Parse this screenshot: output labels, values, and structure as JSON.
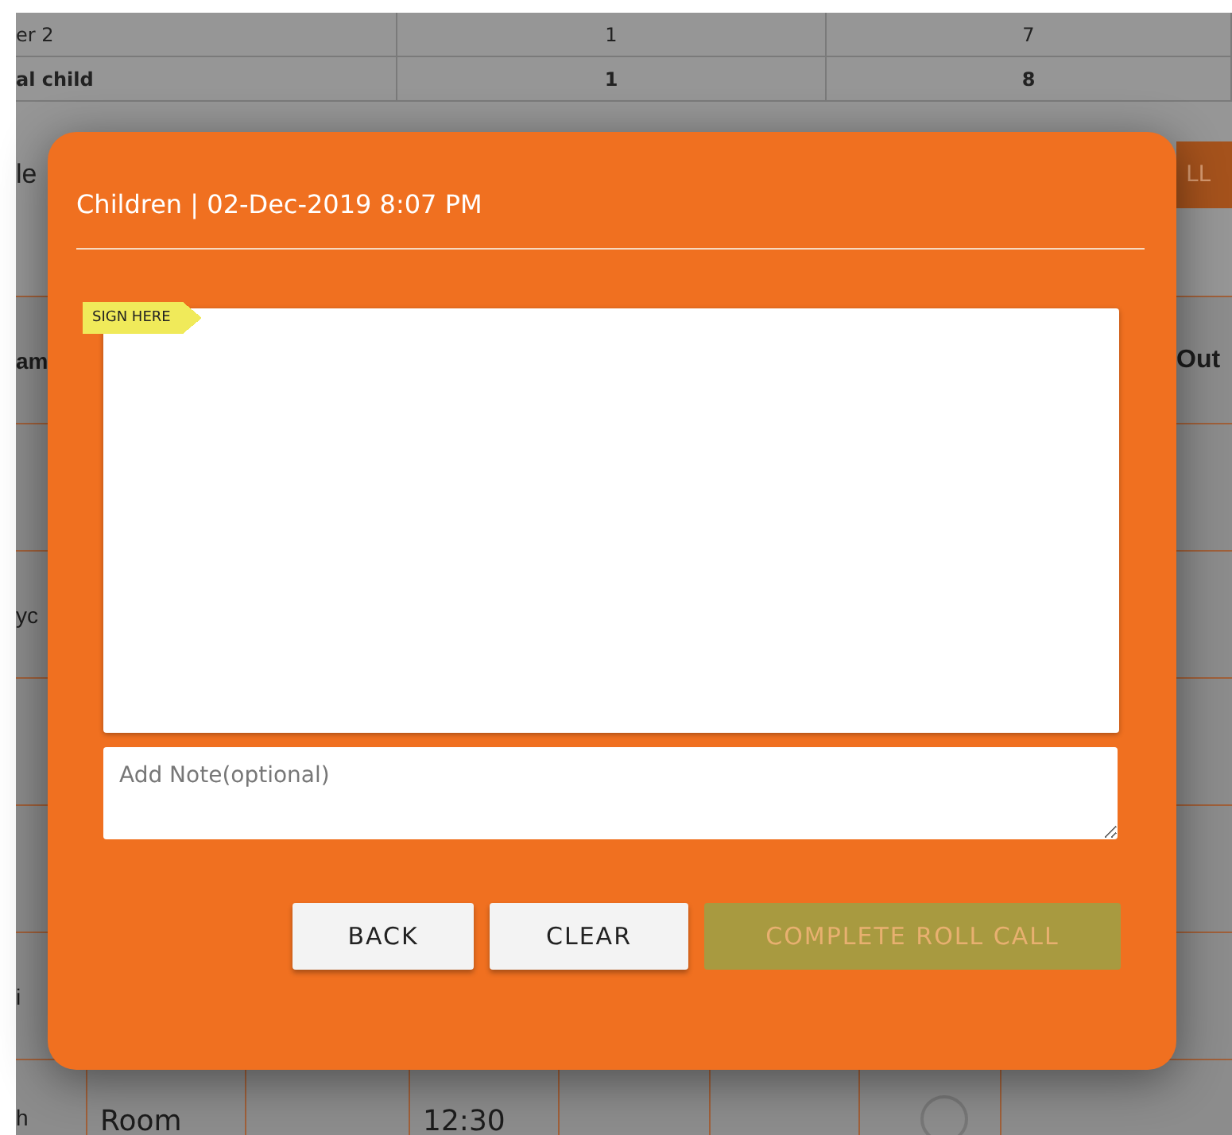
{
  "summary_rows": [
    {
      "label": "er 2",
      "count": "1",
      "total": "7",
      "bold": false
    },
    {
      "label": "al child",
      "count": "1",
      "total": "8",
      "bold": true
    }
  ],
  "section_label": "le",
  "section_button": "LL",
  "grid_rows": [
    {
      "column_1": "am",
      "column_8": "Out"
    },
    {},
    {
      "column_1": "yc"
    },
    {},
    {},
    {
      "column_1": "i"
    },
    {
      "column_1": "h",
      "column_2": "Room",
      "column_4": "12:30",
      "column_7_radio": true
    }
  ],
  "dialog": {
    "title": "Children | 02-Dec-2019 8:07 PM",
    "sign_tag": "SIGN HERE",
    "note": {
      "placeholder": "Add Note(optional)"
    },
    "buttons": [
      {
        "label": "BACK",
        "kind": "plain",
        "disabled": false
      },
      {
        "label": "CLEAR",
        "kind": "plain",
        "disabled": false
      },
      {
        "label": "COMPLETE ROLL CALL",
        "kind": "primary",
        "disabled": true
      }
    ]
  }
}
